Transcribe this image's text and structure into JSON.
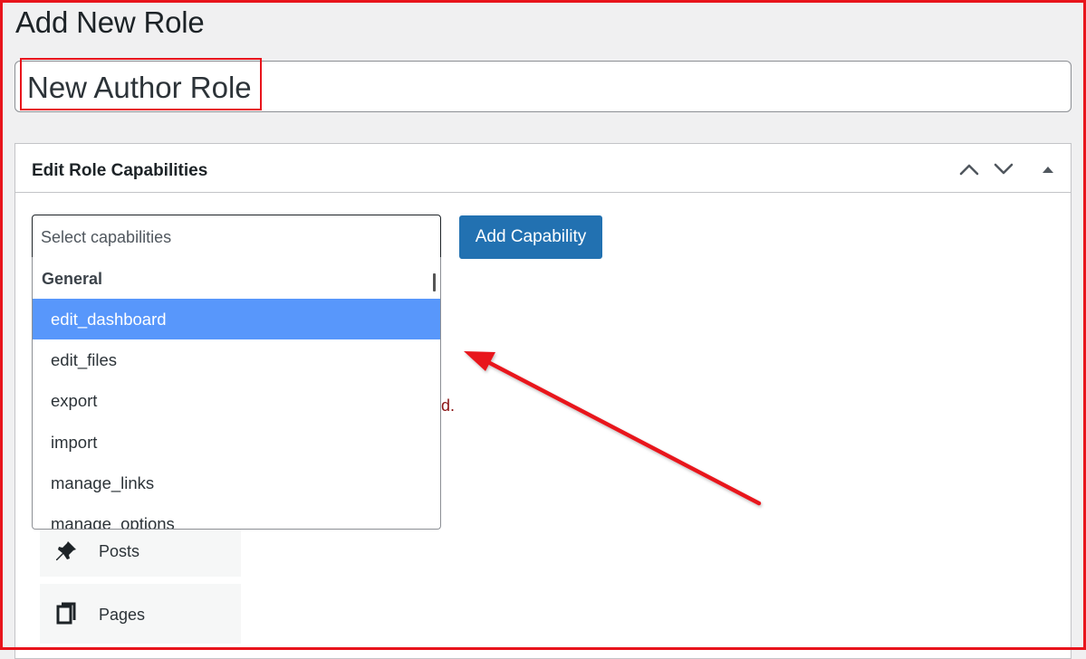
{
  "page": {
    "title": "Add New Role"
  },
  "role_title": {
    "value": "New Author Role"
  },
  "capabilities_box": {
    "title": "Edit Role Capabilities",
    "move_up_icon": "chevron-up-icon",
    "move_down_icon": "chevron-down-icon",
    "toggle_icon": "triangle-up-icon"
  },
  "capability_select": {
    "placeholder": "Select capabilities",
    "add_button": "Add Capability",
    "group_label": "General",
    "options": [
      {
        "label": "edit_dashboard",
        "selected": true
      },
      {
        "label": "edit_files",
        "selected": false
      },
      {
        "label": "export",
        "selected": false
      },
      {
        "label": "import",
        "selected": false
      },
      {
        "label": "manage_links",
        "selected": false
      },
      {
        "label": "manage_options",
        "selected": false
      }
    ]
  },
  "hidden_message_fragment": "d.",
  "sections": [
    {
      "label": "Posts",
      "icon": "pin-icon"
    },
    {
      "label": "Pages",
      "icon": "pages-icon"
    }
  ],
  "colors": {
    "accent": "#2271b1",
    "highlight": "#5897fb",
    "annotation": "#e8141c"
  }
}
